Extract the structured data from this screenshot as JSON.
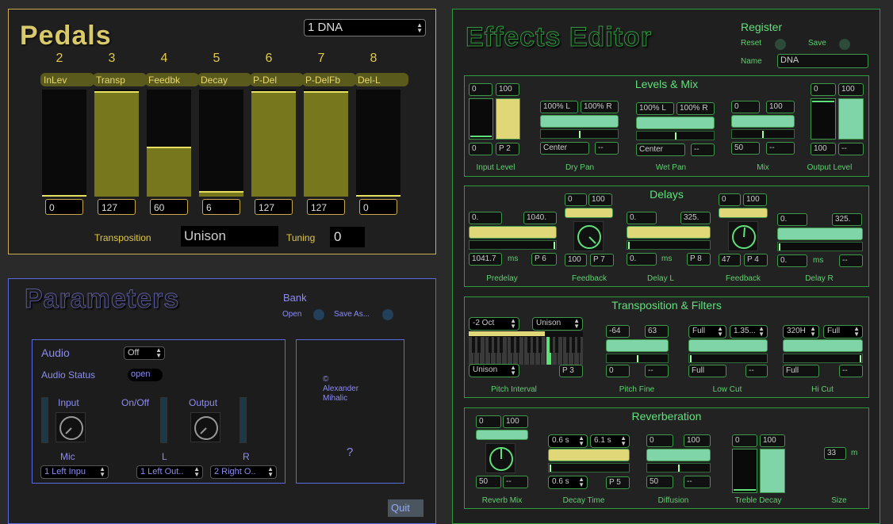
{
  "pedals": {
    "title": "Pedals",
    "preset": "1 DNA",
    "columns": [
      {
        "num": "2",
        "label": "InLev",
        "value": "0",
        "level": 0.0
      },
      {
        "num": "3",
        "label": "Transp",
        "value": "127",
        "level": 1.0
      },
      {
        "num": "4",
        "label": "Feedbk",
        "value": "60",
        "level": 0.47
      },
      {
        "num": "5",
        "label": "Decay",
        "value": "6",
        "level": 0.05
      },
      {
        "num": "6",
        "label": "P-Del",
        "value": "127",
        "level": 1.0
      },
      {
        "num": "7",
        "label": "P-DelFb",
        "value": "127",
        "level": 1.0
      },
      {
        "num": "8",
        "label": "Del-L",
        "value": "0",
        "level": 0.0
      }
    ],
    "transposition_label": "Transposition",
    "transposition_value": "Unison",
    "tuning_label": "Tuning",
    "tuning_value": "0"
  },
  "parameters": {
    "title": "Parameters",
    "bank": "Bank",
    "open": "Open",
    "save_as": "Save As...",
    "audio": {
      "label": "Audio",
      "state": "Off",
      "status_label": "Audio Status",
      "status_value": "open",
      "input": "Input",
      "onoff": "On/Off",
      "output": "Output",
      "mic": "Mic",
      "l": "L",
      "r": "R",
      "in_dev": "1 Left Inpu",
      "out_l": "1 Left Out..",
      "out_r": "2 Right O.."
    },
    "credit": "©\nAlexander\nMihalic",
    "help": "?",
    "quit": "Quit"
  },
  "effects": {
    "title": "Effects Editor",
    "register": "Register",
    "reset": "Reset",
    "save": "Save",
    "name_label": "Name",
    "name_value": "DNA",
    "levels": {
      "title": "Levels & Mix",
      "input": {
        "lo": "0",
        "hi": "100",
        "val": "0",
        "pedal": "P 2",
        "cap": "Input Level"
      },
      "dry": {
        "a": "100% L",
        "b": "100% R",
        "pan": "Center",
        "p": "--",
        "cap": "Dry Pan"
      },
      "wet": {
        "a": "100% L",
        "b": "100% R",
        "pan": "Center",
        "p": "--",
        "cap": "Wet Pan"
      },
      "mix": {
        "a": "0",
        "b": "100",
        "val": "50",
        "p": "--",
        "cap": "Mix"
      },
      "output": {
        "lo": "0",
        "hi": "100",
        "val": "100",
        "p": "--",
        "cap": "Output Level"
      }
    },
    "delays": {
      "title": "Delays",
      "predelay": {
        "a": "0.",
        "b": "1040.",
        "val": "1041.7",
        "unit": "ms",
        "p": "P 6",
        "cap": "Predelay"
      },
      "fb1": {
        "a": "0",
        "b": "100",
        "val": "100",
        "p": "P 7",
        "cap": "Feedback"
      },
      "dell": {
        "a": "0.",
        "b": "325.",
        "val": "0.",
        "unit": "ms",
        "p": "P 8",
        "cap": "Delay L"
      },
      "fb2": {
        "a": "0",
        "b": "100",
        "val": "47",
        "p": "P 4",
        "cap": "Feedback"
      },
      "delr": {
        "a": "0.",
        "b": "325.",
        "val": "0.",
        "unit": "ms",
        "p": "--",
        "cap": "Delay R"
      }
    },
    "trans": {
      "title": "Transposition & Filters",
      "pitch": {
        "a": "-2 Oct",
        "b": "Unison",
        "c": "Unison",
        "p": "P 3",
        "cap": "Pitch Interval"
      },
      "fine": {
        "a": "-64",
        "b": "63",
        "val": "0",
        "p": "--",
        "cap": "Pitch Fine"
      },
      "low": {
        "a": "Full",
        "b": "1.35...",
        "val": "Full",
        "p": "--",
        "cap": "Low Cut"
      },
      "hi": {
        "a": "320H",
        "b": "Full",
        "val": "Full",
        "p": "--",
        "cap": "Hi Cut"
      }
    },
    "reverb": {
      "title": "Reverberation",
      "mix": {
        "a": "0",
        "b": "100",
        "val": "50",
        "p": "--",
        "cap": "Reverb Mix"
      },
      "decay": {
        "a": "0.6 s",
        "b": "6.1 s",
        "val": "0.6 s",
        "p": "P 5",
        "cap": "Decay Time"
      },
      "diff": {
        "a": "0",
        "b": "100",
        "val": "50",
        "p": "--",
        "cap": "Diffusion"
      },
      "treble": {
        "a": "0",
        "b": "100",
        "cap": "Treble Decay"
      },
      "size": {
        "val": "33",
        "unit": "m",
        "cap": "Size"
      }
    }
  }
}
